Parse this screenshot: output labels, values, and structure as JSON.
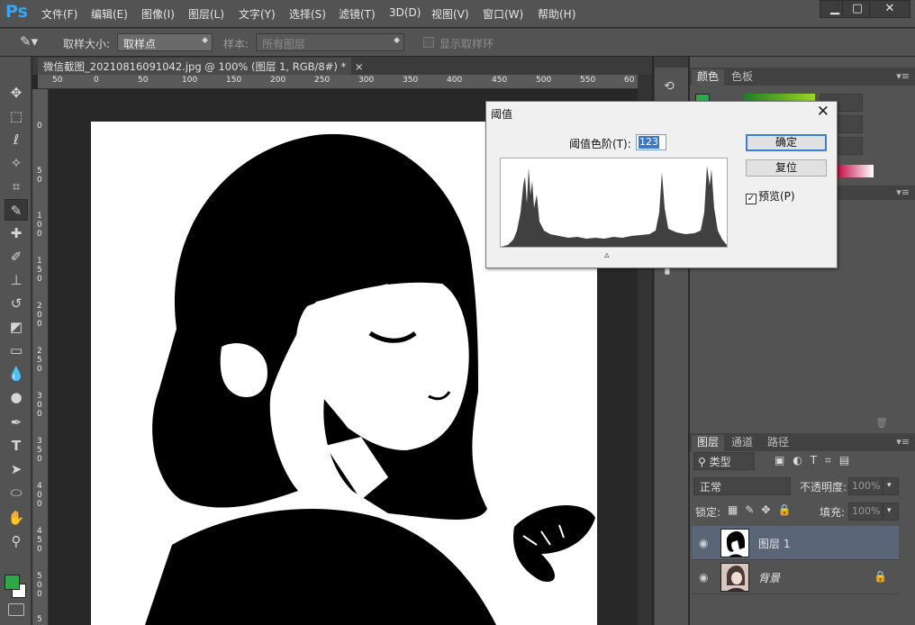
{
  "app": {
    "logo": "Ps",
    "menu": [
      "文件(F)",
      "编辑(E)",
      "图像(I)",
      "图层(L)",
      "文字(Y)",
      "选择(S)",
      "滤镜(T)",
      "3D(D)",
      "视图(V)",
      "窗口(W)",
      "帮助(H)"
    ],
    "window_buttons": {
      "minimize": "▁",
      "maximize": "▢",
      "close": "✕"
    }
  },
  "options_bar": {
    "sample_size_label": "取样大小:",
    "sample_size_value": "取样点",
    "sample_label": "样本:",
    "sample_value": "所有图层",
    "show_ring_label": "显示取样环"
  },
  "document": {
    "tab_title": "微信截图_20210816091042.jpg @ 100% (图层 1, RGB/8#) *",
    "tab_close": "×",
    "ruler_h_ticks": [
      "50",
      "0",
      "50",
      "100",
      "150",
      "200",
      "250",
      "300",
      "350",
      "400",
      "450",
      "500",
      "550",
      "60"
    ],
    "ruler_v_ticks": [
      "0",
      "5 0",
      "1 0 0",
      "1 5 0",
      "2 0 0",
      "2 5 0",
      "3 0 0",
      "3 5 0",
      "4 0 0",
      "4 5 0",
      "5 0 0",
      "5"
    ]
  },
  "panels": {
    "color_tabs": [
      "颜色",
      "色板"
    ],
    "layers_tabs": [
      "图层",
      "通道",
      "路径"
    ],
    "filter_kind": "类型",
    "blend_mode": "正常",
    "opacity_label": "不透明度:",
    "opacity_value": "100%",
    "lock_label": "锁定:",
    "fill_label": "填充:",
    "fill_value": "100%",
    "layers": [
      {
        "name": "图层 1",
        "selected": true
      },
      {
        "name": "背景",
        "selected": false,
        "locked": true
      }
    ]
  },
  "threshold_dialog": {
    "title": "阈值",
    "close": "✕",
    "level_label": "阈值色阶(T):",
    "level_value": "123",
    "ok_label": "确定",
    "reset_label": "复位",
    "preview_label": "预览(P)",
    "preview_checked": true
  },
  "colors": {
    "foreground": "#2fa84a",
    "background": "#ffffff",
    "accent_blue": "#31a8ff",
    "selected_layer": "#5a6577"
  },
  "icons": [
    "move-icon",
    "marquee-icon",
    "lasso-icon",
    "quick-select-icon",
    "crop-icon",
    "eyedropper-icon",
    "healing-icon",
    "brush-icon",
    "stamp-icon",
    "history-brush-icon",
    "eraser-icon",
    "gradient-icon",
    "blur-icon",
    "dodge-icon",
    "pen-icon",
    "type-icon",
    "path-select-icon",
    "ellipse-icon",
    "hand-icon",
    "zoom-icon"
  ]
}
